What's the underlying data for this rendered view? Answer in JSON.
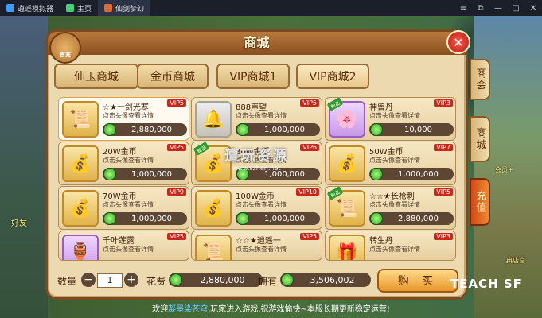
{
  "emulator": {
    "tabs": [
      {
        "label": "逍遥模拟器",
        "icon": "emulator-logo-icon"
      },
      {
        "label": "主页",
        "icon": "home-icon"
      },
      {
        "label": "仙剑梦幻",
        "icon": "game-icon"
      }
    ],
    "window_controls": [
      "≡",
      "⧉",
      "—",
      "□",
      "✕"
    ]
  },
  "shop": {
    "title": "商城",
    "logo_label": "首充",
    "close_label": "✕",
    "categories": [
      "仙玉商城",
      "金币商城",
      "VIP商城1",
      "VIP商城2"
    ],
    "side_tabs": [
      "商会",
      "商城",
      "充值"
    ],
    "items": [
      {
        "name": "☆★一剑光寒",
        "vip": "VIP5",
        "desc": "点击头像查看详情",
        "price": "2,880,000",
        "icon": "scroll-icon",
        "tag": ""
      },
      {
        "name": "888声望",
        "vip": "VIP5",
        "desc": "点击头像查看详情",
        "price": "1,000,000",
        "icon": "bell-icon",
        "tag": ""
      },
      {
        "name": "神兽丹",
        "vip": "VIP3",
        "desc": "点击头像查看详情",
        "price": "10,000",
        "icon": "pill-icon",
        "tag": "新品"
      },
      {
        "name": "20W金币",
        "vip": "VIP5",
        "desc": "点击头像查看详情",
        "price": "1,000,000",
        "icon": "coin-bag-icon",
        "tag": ""
      },
      {
        "name": "30W金币",
        "vip": "VIP6",
        "desc": "点击头像查看详情",
        "price": "1,000,000",
        "icon": "coin-bag-icon",
        "tag": "新品"
      },
      {
        "name": "50W金币",
        "vip": "VIP7",
        "desc": "点击头像查看详情",
        "price": "1,000,000",
        "icon": "coin-bag-icon",
        "tag": ""
      },
      {
        "name": "70W金币",
        "vip": "VIP9",
        "desc": "点击头像查看详情",
        "price": "1,000,000",
        "icon": "coin-bag-icon",
        "tag": ""
      },
      {
        "name": "100W金币",
        "vip": "VIP10",
        "desc": "点击头像查看详情",
        "price": "1,000,000",
        "icon": "coin-bag-icon",
        "tag": ""
      },
      {
        "name": "☆☆★长枪刺",
        "vip": "VIP5",
        "desc": "点击头像查看详情",
        "price": "2,880,000",
        "icon": "scroll-icon",
        "tag": "新品"
      },
      {
        "name": "千叶莲露",
        "vip": "VIP5",
        "desc": "点击头像查看详情",
        "price": "",
        "icon": "potion-icon",
        "tag": ""
      },
      {
        "name": "☆☆★逍遥一",
        "vip": "VIP5",
        "desc": "点击头像查看详情",
        "price": "",
        "icon": "scroll-icon",
        "tag": ""
      },
      {
        "name": "转生丹",
        "vip": "VIP3",
        "desc": "点击头像查看详情",
        "price": "",
        "icon": "chest-icon",
        "tag": ""
      }
    ],
    "quantity_label": "数量",
    "quantity_value": "1",
    "minus_label": "−",
    "plus_label": "+",
    "cost_label": "花费",
    "cost_value": "2,880,000",
    "owned_label": "拥有",
    "owned_value": "3,506,002",
    "buy_label": "购 买"
  },
  "marquee": {
    "prefix": "欢迎",
    "highlight": "凝墨染苍穹",
    "suffix": ",玩家进入游戏,祝游戏愉快~本服长期更新稳定运营!"
  },
  "watermark": {
    "line1": "遭玩资源",
    "line2": "www.szhen.net",
    "corner": "TEACH SF"
  },
  "side_text": {
    "left_friend": "好友",
    "right_member": "会员+",
    "right_shop": "典店官"
  }
}
